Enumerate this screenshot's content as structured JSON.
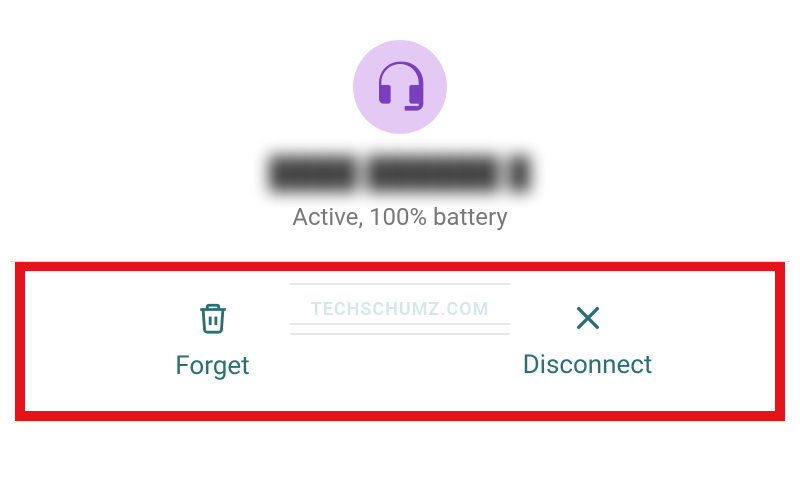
{
  "device": {
    "name": "████ ██████ █",
    "status": "Active, 100% battery"
  },
  "actions": {
    "forget": {
      "label": "Forget"
    },
    "disconnect": {
      "label": "Disconnect"
    }
  },
  "watermark": "TECHSCHUMZ.COM",
  "colors": {
    "accent": "#2a6f74",
    "iconBg": "#e4c9f5",
    "iconFg": "#7a3fbf",
    "highlight": "#e6131b"
  }
}
